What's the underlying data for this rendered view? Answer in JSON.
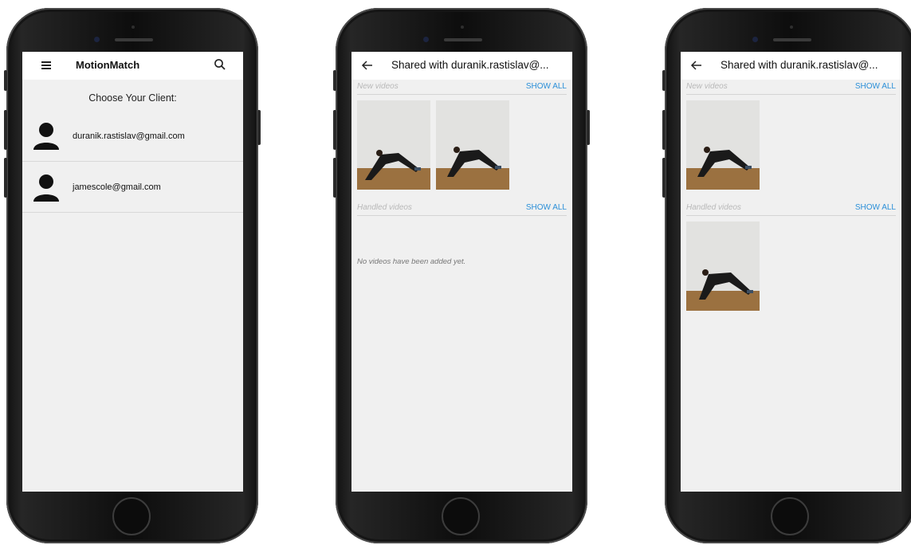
{
  "screen1": {
    "app_title": "MotionMatch",
    "choose_label": "Choose Your Client:",
    "clients": [
      {
        "email": "duranik.rastislav@gmail.com"
      },
      {
        "email": "jamescole@gmail.com"
      }
    ]
  },
  "screen2": {
    "title": "Shared with duranik.rastislav@...",
    "new_label": "New videos",
    "handled_label": "Handled videos",
    "show_all": "SHOW ALL",
    "empty_message": "No videos have been added yet."
  },
  "screen3": {
    "title": "Shared with duranik.rastislav@...",
    "new_label": "New videos",
    "handled_label": "Handled videos",
    "show_all": "SHOW ALL"
  },
  "colors": {
    "accent": "#2b8fd8",
    "screen_bg": "#f0f0f0",
    "floor": "#9b7140"
  },
  "icons": [
    "menu-icon",
    "search-icon",
    "avatar-icon",
    "back-arrow-icon",
    "home-button"
  ]
}
